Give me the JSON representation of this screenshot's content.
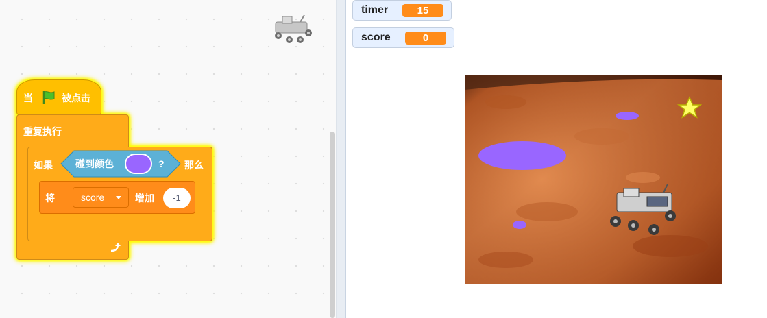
{
  "code": {
    "hat": {
      "when": "当",
      "flag_icon": "green-flag-icon",
      "clicked": "被点击"
    },
    "forever": {
      "label": "重复执行",
      "loop_icon": "loop-arrow-icon"
    },
    "if_block": {
      "if_label": "如果",
      "then_label": "那么"
    },
    "touching_color": {
      "label": "碰到颜色",
      "color": "#9966ff",
      "question": "?"
    },
    "change_var": {
      "set_label": "将",
      "variable": "score",
      "by_label": "增加",
      "value": "-1"
    }
  },
  "monitors": [
    {
      "name": "timer",
      "value": "15"
    },
    {
      "name": "score",
      "value": "0"
    }
  ],
  "stage": {
    "background": "mars-terrain",
    "sprites": [
      "rover",
      "star",
      "purple-ellipse-large",
      "purple-ellipse-small",
      "purple-ellipse-tiny"
    ],
    "target_color": "#9966ff"
  },
  "colors": {
    "events": "#ffbf00",
    "control": "#ffab19",
    "variables": "#ff8c1a",
    "sensing": "#5cb1d6",
    "glow": "#ffff00"
  }
}
